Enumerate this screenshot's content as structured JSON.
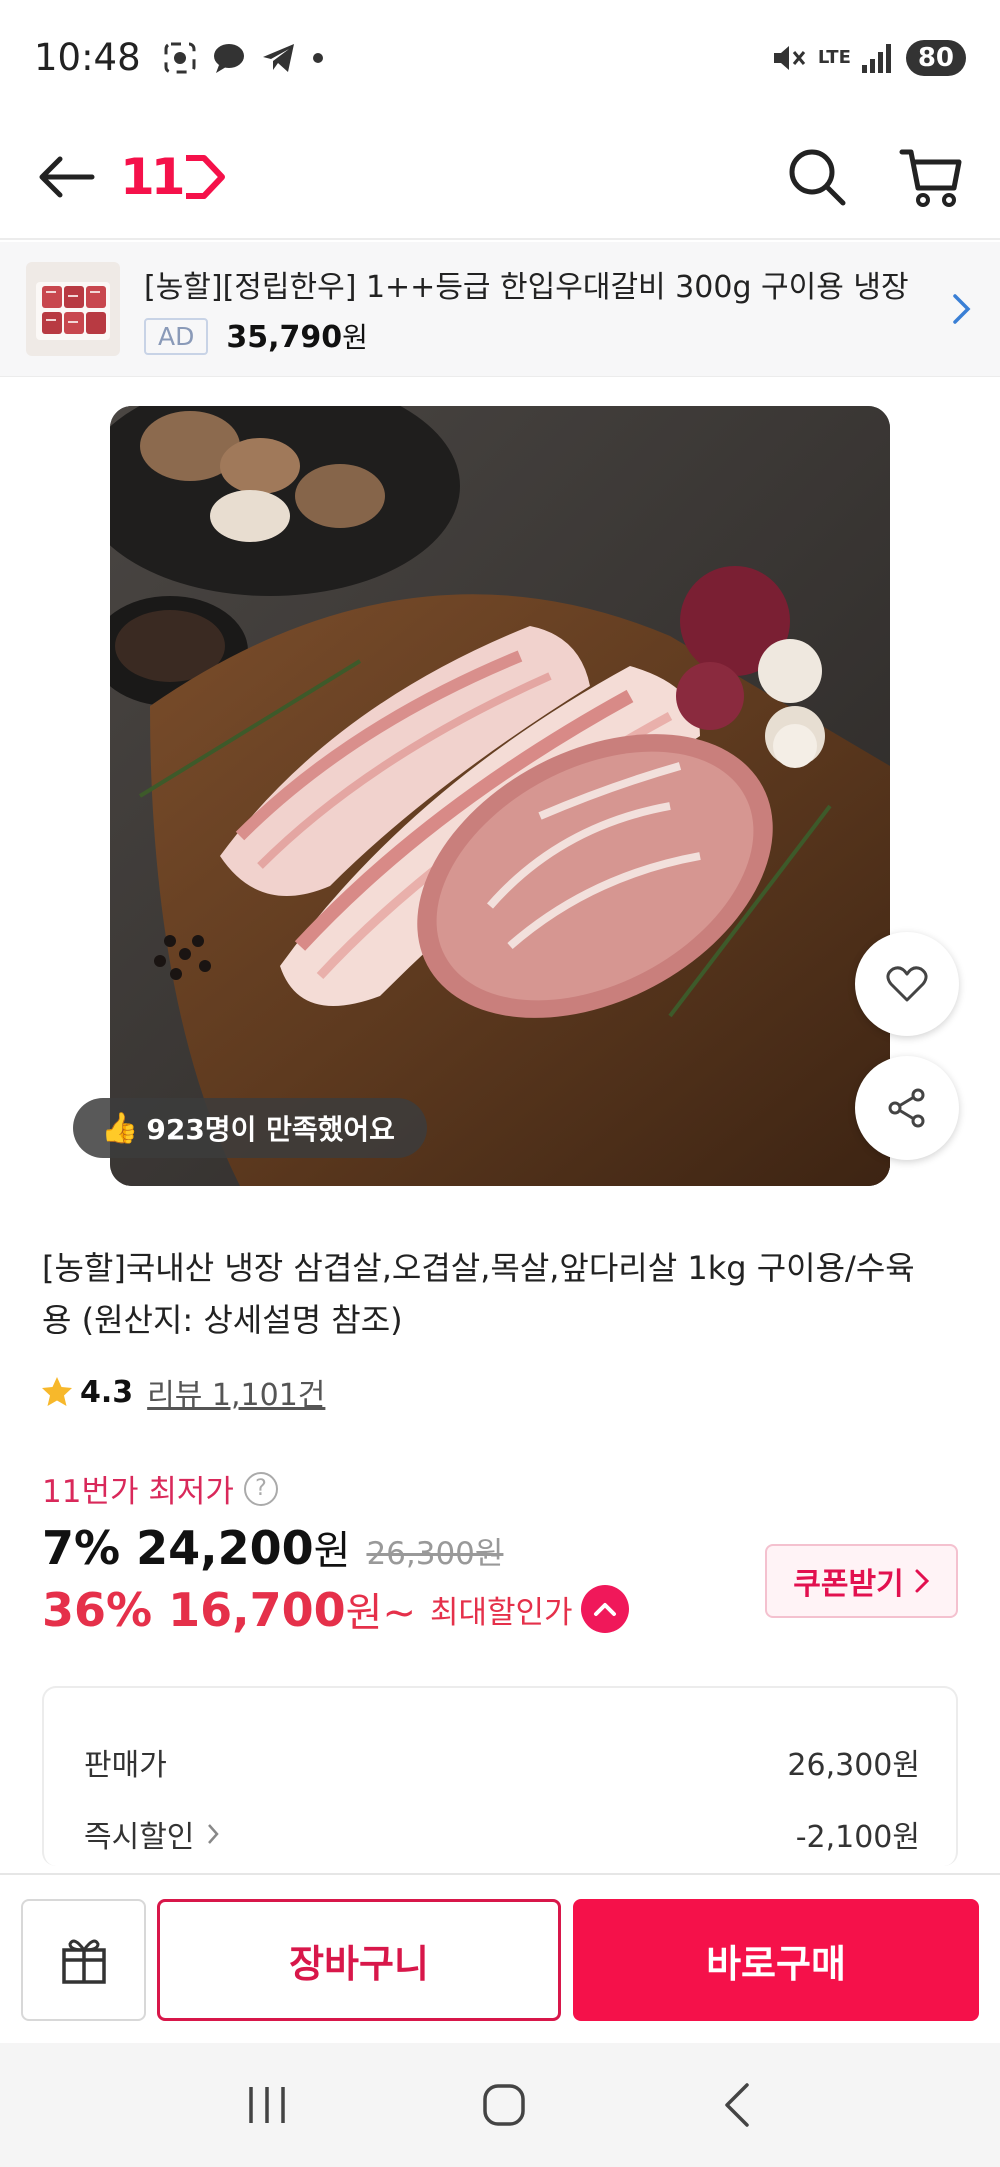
{
  "status_bar": {
    "time": "10:48",
    "network": "LTE",
    "battery": "80"
  },
  "app_bar": {
    "logo": "11",
    "icons": [
      "back-arrow-icon",
      "search-icon",
      "cart-icon"
    ]
  },
  "ad_banner": {
    "title": "[농할][정립한우] 1++등급 한입우대갈비 300g 구이용 냉장",
    "badge": "AD",
    "price": "35,790",
    "price_unit": "원"
  },
  "product": {
    "satisfaction": "923명이 만족했어요",
    "title": "[농할]국내산 냉장 삼겹살,오겹살,목살,앞다리살 1kg 구이용/수육용 (원산지: 상세설명 참조)",
    "rating": "4.3",
    "review_link": "리뷰 1,101건"
  },
  "pricing": {
    "lowest_label": "11번가 최저가",
    "help": "?",
    "discount_price": "7% 24,200",
    "discount_price_unit": "원",
    "original_price": "26,300원",
    "max_discount_price": "36% 16,700",
    "max_discount_suffix": "원~",
    "max_discount_label": "최대할인가",
    "coupon_button": "쿠폰받기"
  },
  "detail_box": {
    "rows": [
      {
        "label": "판매가",
        "value": "26,300원"
      },
      {
        "label": "즉시할인",
        "value": "-2,100원"
      }
    ]
  },
  "bottom_bar": {
    "cart_button": "장바구니",
    "buy_button": "바로구매"
  },
  "colors": {
    "brand": "#f5114a",
    "price_red": "#e5304a",
    "lowest_pink": "#d9285a"
  }
}
